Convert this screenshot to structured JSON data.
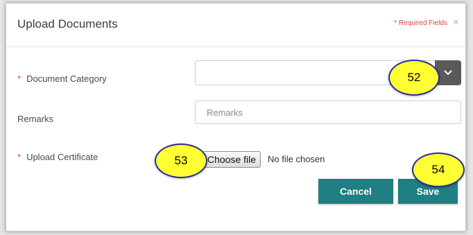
{
  "dialog": {
    "title": "Upload Documents",
    "required_note": "* Required Fields",
    "close_glyph": "×"
  },
  "form": {
    "document_category": {
      "label": "Document Category",
      "required_marker": "*",
      "selected": ""
    },
    "remarks": {
      "label": "Remarks",
      "placeholder": "Remarks",
      "value": ""
    },
    "upload_certificate": {
      "label": "Upload Certificate",
      "required_marker": "*",
      "button_label": "Choose file",
      "status": "No file chosen"
    }
  },
  "actions": {
    "cancel_label": "Cancel",
    "save_label": "Save"
  },
  "callouts": {
    "category_dropdown": "52",
    "choose_file": "53",
    "save": "54"
  },
  "colors": {
    "accent": "#1f7f82",
    "required": "#e0424b",
    "callout_fill": "#ffff33",
    "callout_border": "#2b2b9a"
  },
  "icons": {
    "close": "close-icon",
    "dropdown": "chevron-down-icon"
  }
}
